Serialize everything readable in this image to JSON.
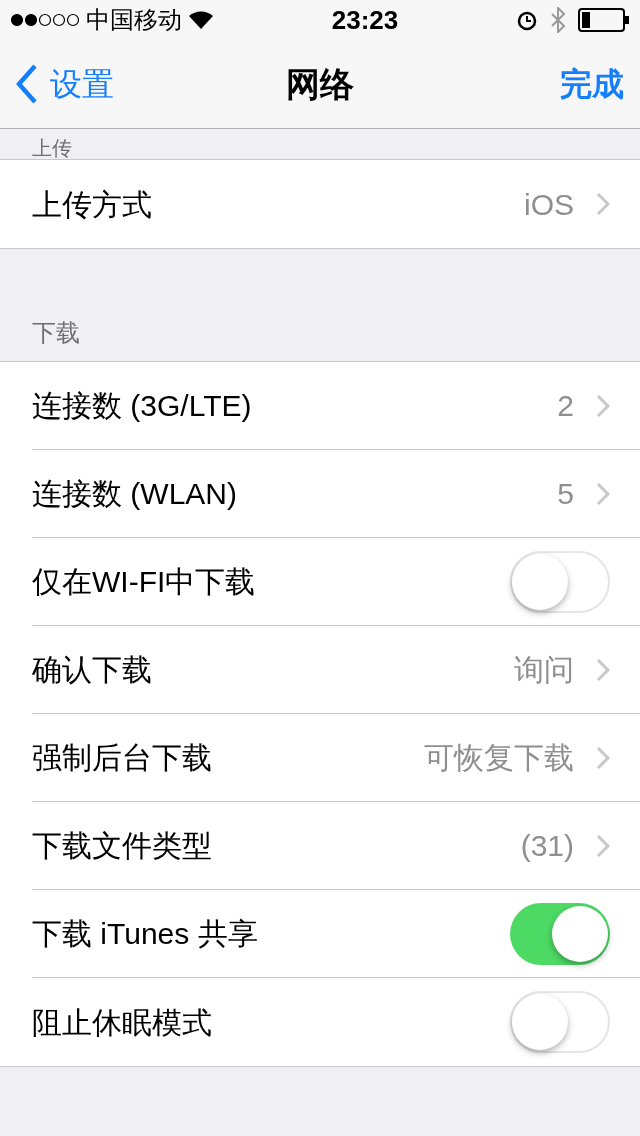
{
  "status_bar": {
    "carrier": "中国移动",
    "time": "23:23"
  },
  "nav": {
    "back": "设置",
    "title": "网络",
    "done": "完成"
  },
  "sections": [
    {
      "header": "上传",
      "rows": [
        {
          "kind": "value",
          "label": "上传方式",
          "value": "iOS"
        }
      ]
    },
    {
      "header": "下载",
      "rows": [
        {
          "kind": "value",
          "label": "连接数 (3G/LTE)",
          "value": "2"
        },
        {
          "kind": "value",
          "label": "连接数 (WLAN)",
          "value": "5"
        },
        {
          "kind": "toggle",
          "label": "仅在WI-FI中下载",
          "on": false
        },
        {
          "kind": "value",
          "label": "确认下载",
          "value": "询问"
        },
        {
          "kind": "value",
          "label": "强制后台下载",
          "value": "可恢复下载"
        },
        {
          "kind": "value",
          "label": "下载文件类型",
          "value": "(31)"
        },
        {
          "kind": "toggle",
          "label": "下载 iTunes 共享",
          "on": true
        },
        {
          "kind": "toggle",
          "label": "阻止休眠模式",
          "on": false
        }
      ]
    }
  ]
}
